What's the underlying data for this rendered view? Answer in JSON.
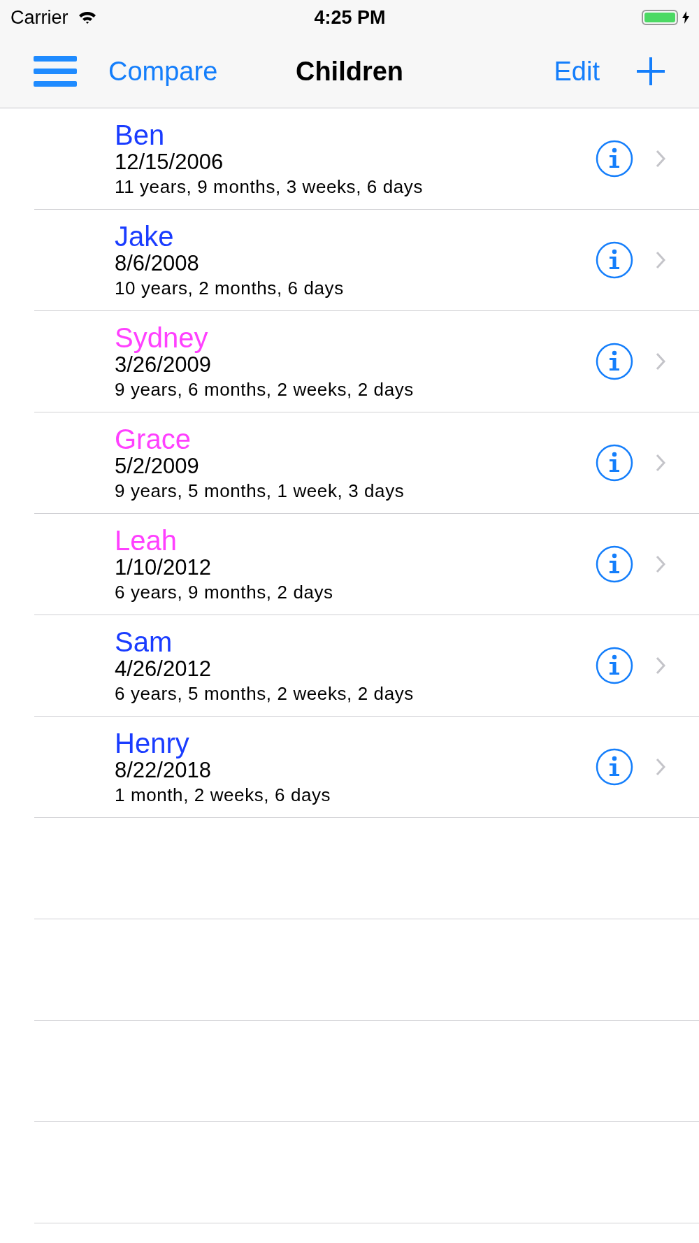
{
  "status_bar": {
    "carrier": "Carrier",
    "time": "4:25 PM"
  },
  "nav_bar": {
    "left": "Compare",
    "title": "Children",
    "right": "Edit"
  },
  "children": [
    {
      "name": "Ben",
      "color": "#1a3cff",
      "birthdate": "12/15/2006",
      "age": "11 years, 9 months, 3 weeks, 6 days"
    },
    {
      "name": "Jake",
      "color": "#1a3cff",
      "birthdate": "8/6/2008",
      "age": "10 years, 2 months, 6 days"
    },
    {
      "name": "Sydney",
      "color": "#ff40ff",
      "birthdate": "3/26/2009",
      "age": "9 years, 6 months, 2 weeks, 2 days"
    },
    {
      "name": "Grace",
      "color": "#ff40ff",
      "birthdate": "5/2/2009",
      "age": "9 years, 5 months, 1 week, 3 days"
    },
    {
      "name": "Leah",
      "color": "#ff40ff",
      "birthdate": "1/10/2012",
      "age": "6 years, 9 months, 2 days"
    },
    {
      "name": "Sam",
      "color": "#1a3cff",
      "birthdate": "4/26/2012",
      "age": "6 years, 5 months, 2 weeks, 2 days"
    },
    {
      "name": "Henry",
      "color": "#1a3cff",
      "birthdate": "8/22/2018",
      "age": "1 month, 2 weeks, 6 days"
    }
  ]
}
